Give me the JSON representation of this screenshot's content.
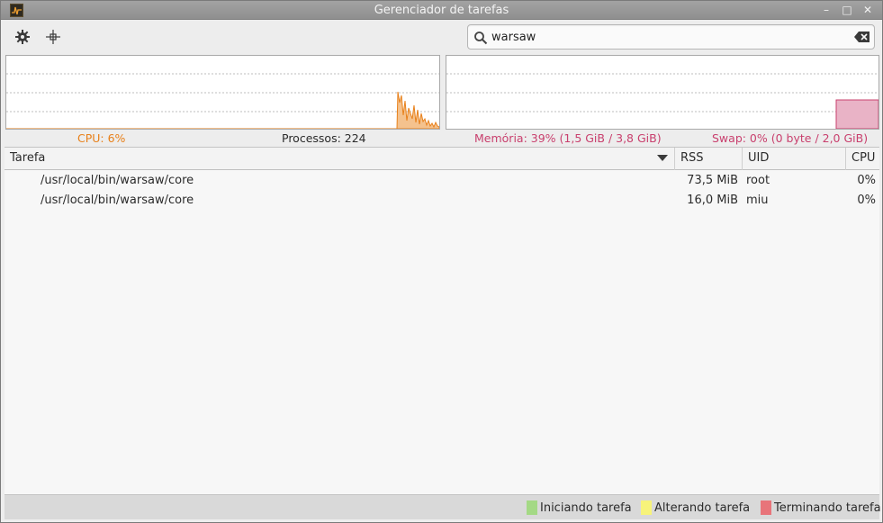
{
  "window": {
    "title": "Gerenciador de tarefas",
    "controls": {
      "minimize": "–",
      "maximize": "□",
      "close": "✕"
    }
  },
  "toolbar": {
    "settings_icon": "gear-icon",
    "crosshair_icon": "crosshair-icon",
    "search": {
      "value": "warsaw",
      "placeholder": ""
    }
  },
  "colors": {
    "cpu": "#e8801a",
    "memory": "#c9406e",
    "memory_fill": "#e9b3c6",
    "starting": "#a4d985",
    "changing": "#f7f37a",
    "terminating": "#e8747a"
  },
  "stats": {
    "cpu": "CPU: 6%",
    "processes": "Processos: 224",
    "memory": "Memória: 39% (1,5 GiB / 3,8 GiB)",
    "swap": "Swap: 0% (0 byte / 2,0 GiB)"
  },
  "table": {
    "columns": [
      "Tarefa",
      "RSS",
      "UID",
      "CPU"
    ],
    "rows": [
      {
        "task": "/usr/local/bin/warsaw/core",
        "rss": "73,5 MiB",
        "uid": "root",
        "cpu": "0%"
      },
      {
        "task": "/usr/local/bin/warsaw/core",
        "rss": "16,0 MiB",
        "uid": "miu",
        "cpu": "0%"
      }
    ]
  },
  "legend": {
    "starting": "Iniciando tarefa",
    "changing": "Alterando tarefa",
    "terminating": "Terminando tarefa"
  }
}
